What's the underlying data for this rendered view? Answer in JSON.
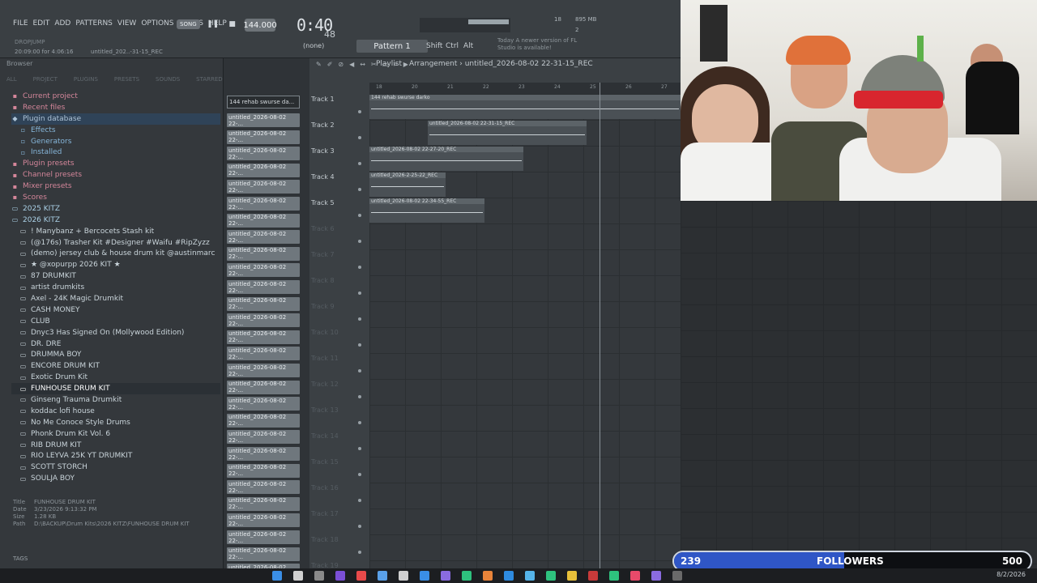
{
  "menu": [
    "FILE",
    "EDIT",
    "ADD",
    "PATTERNS",
    "VIEW",
    "OPTIONS",
    "TOOLS",
    "HELP"
  ],
  "hint": "DROPJUMP",
  "song_time": "20:09:00 for 4:06:16",
  "project_name": "untitled_202..-31-15_REC",
  "song_mode": "SONG",
  "tempo": "144.000",
  "time": "0:40",
  "time_ms": "48",
  "cpu": "18",
  "mem": "895 MB",
  "mem2": "2",
  "mem_small": "18",
  "pattern": "Pattern 1",
  "none": "(none)",
  "mods": [
    "Shift",
    "Ctrl",
    "Alt"
  ],
  "news": "Today A newer version of FL Studio is available!",
  "browser": {
    "header": "Browser",
    "tabs": [
      "ALL",
      "PROJECT",
      "PLUGINS",
      "PRESETS",
      "SOUNDS",
      "STARRED"
    ],
    "items": [
      {
        "label": "Current project",
        "type": "cat"
      },
      {
        "label": "Recent files",
        "type": "cat"
      },
      {
        "label": "Plugin database",
        "type": "db"
      },
      {
        "label": "Effects",
        "type": "sub"
      },
      {
        "label": "Generators",
        "type": "sub"
      },
      {
        "label": "Installed",
        "type": "sub"
      },
      {
        "label": "Plugin presets",
        "type": "cat"
      },
      {
        "label": "Channel presets",
        "type": "cat"
      },
      {
        "label": "Mixer presets",
        "type": "cat"
      },
      {
        "label": "Scores",
        "type": "cat"
      },
      {
        "label": "2025 KITZ",
        "type": "fold"
      },
      {
        "label": "2026 KITZ",
        "type": "fold"
      },
      {
        "label": "! Manybanz + Bercocets Stash kit",
        "type": "folder"
      },
      {
        "label": "(@176s) Trasher Kit #Designer #Waifu #RipZyzz",
        "type": "folder"
      },
      {
        "label": "(demo) jersey club & house drum kit @austinmarc",
        "type": "folder"
      },
      {
        "label": "★ @xopurpp 2026 KIT ★",
        "type": "folder"
      },
      {
        "label": "87 DRUMKIT",
        "type": "folder"
      },
      {
        "label": "artist drumkits",
        "type": "folder"
      },
      {
        "label": "Axel - 24K Magic Drumkit",
        "type": "folder"
      },
      {
        "label": "CASH MONEY",
        "type": "folder"
      },
      {
        "label": "CLUB",
        "type": "folder"
      },
      {
        "label": "Dnyc3 Has Signed On (Mollywood Edition)",
        "type": "folder"
      },
      {
        "label": "DR. DRE",
        "type": "folder"
      },
      {
        "label": "DRUMMA BOY",
        "type": "folder"
      },
      {
        "label": "ENCORE DRUM KIT",
        "type": "folder"
      },
      {
        "label": "Exotic Drum Kit",
        "type": "folder"
      },
      {
        "label": "FUNHOUSE DRUM KIT",
        "type": "folder",
        "selected": true
      },
      {
        "label": "Ginseng Trauma Drumkit",
        "type": "folder"
      },
      {
        "label": "koddac lofi house",
        "type": "folder"
      },
      {
        "label": "No Me Conoce Style Drums",
        "type": "folder"
      },
      {
        "label": "Phonk Drum Kit Vol. 6",
        "type": "folder"
      },
      {
        "label": "RIB DRUM KIT",
        "type": "folder"
      },
      {
        "label": "RIO LEYVA 25K YT DRUMKIT",
        "type": "folder"
      },
      {
        "label": "SCOTT STORCH",
        "type": "folder"
      },
      {
        "label": "SOULJA BOY",
        "type": "folder"
      }
    ],
    "info": {
      "title_k": "Title",
      "title_v": "FUNHOUSE DRUM KIT",
      "date_k": "Date",
      "date_v": "3/23/2026 9:13:32 PM",
      "size_k": "Size",
      "size_v": "1.28 KB",
      "path_k": "Path",
      "path_v": "D:\\BACKUP\\Drum Kits\\2026 KITZ\\FUNHOUSE DRUM KIT"
    },
    "tags": "TAGS"
  },
  "picker": {
    "first": "144 rehab swurse da...",
    "clip_label": "untitled_2026-08-02 22-...",
    "count": 28
  },
  "playlist": {
    "title": "Playlist - Arrangement",
    "project": "untitled_2026-08-02 22-31-15_REC",
    "ruler": [
      "18",
      "20",
      "21",
      "22",
      "23",
      "24",
      "25",
      "26",
      "27"
    ],
    "tracks": [
      "Track 1",
      "Track 2",
      "Track 3",
      "Track 4",
      "Track 5",
      "Track 6",
      "Track 7",
      "Track 8",
      "Track 9",
      "Track 10",
      "Track 11",
      "Track 12",
      "Track 13",
      "Track 14",
      "Track 15",
      "Track 16",
      "Track 17",
      "Track 18",
      "Track 19"
    ],
    "clips": [
      {
        "label": "144 rehab swurse darko",
        "track": 0
      },
      {
        "label": "untitled_2026-08-02 22-31-15_REC",
        "track": 1
      },
      {
        "label": "untitled_2026-08-02 22-27-20_REC",
        "track": 2
      },
      {
        "label": "untitled_2026-2-25-22_REC",
        "track": 3
      },
      {
        "label": "untitled_2026-08-02 22-34-55_REC",
        "track": 4
      }
    ]
  },
  "followers": {
    "current": 239,
    "label": "FOLLOWERS",
    "goal": 500,
    "fraction": 0.478
  },
  "taskbar_date": "8/2/2026",
  "colors": {
    "accent": "#2f56c6",
    "record": "#e0484a",
    "db_highlight": "#2f4358"
  }
}
